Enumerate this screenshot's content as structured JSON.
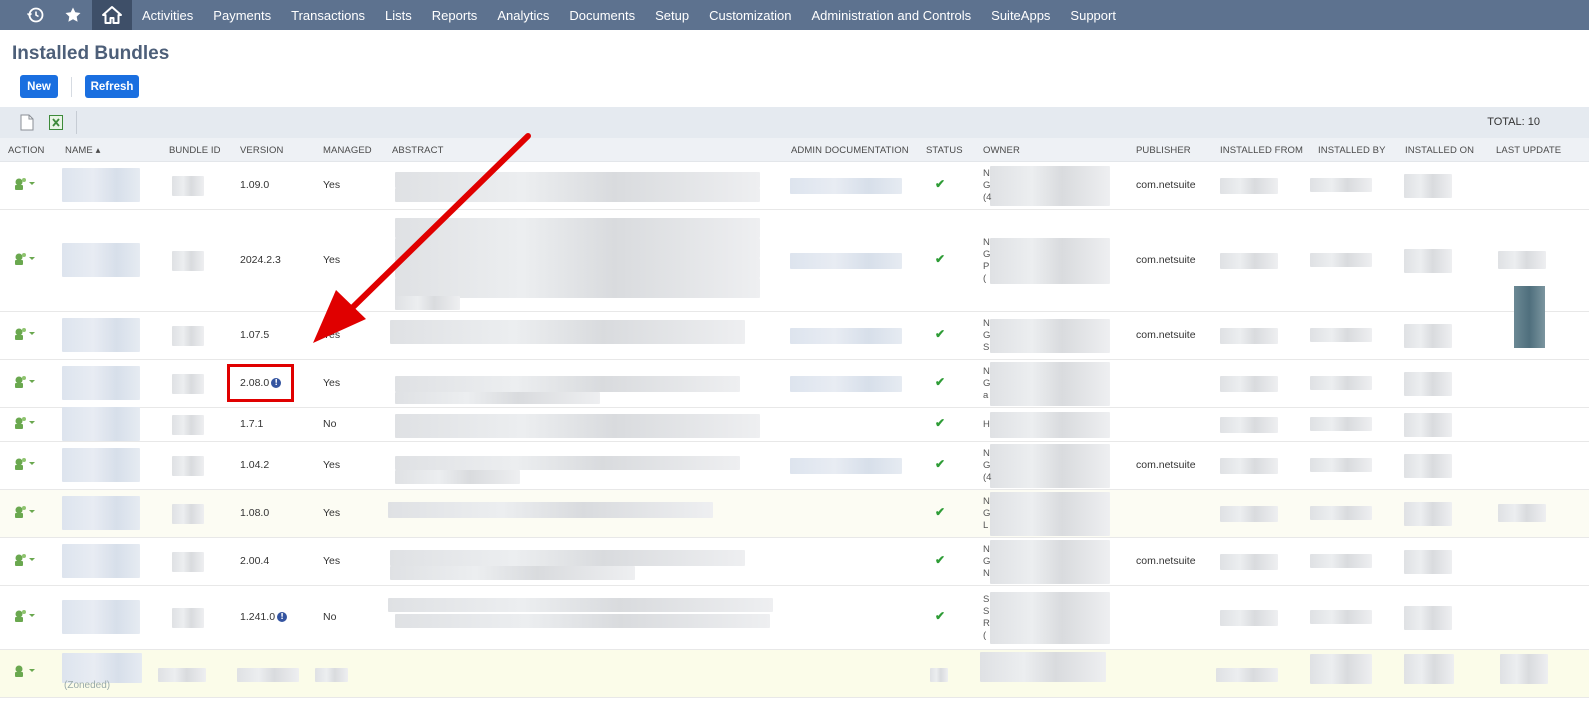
{
  "nav": {
    "items": [
      "Activities",
      "Payments",
      "Transactions",
      "Lists",
      "Reports",
      "Analytics",
      "Documents",
      "Setup",
      "Customization",
      "Administration and Controls",
      "SuiteApps",
      "Support"
    ]
  },
  "page": {
    "title": "Installed Bundles",
    "new_label": "New",
    "refresh_label": "Refresh",
    "total": "TOTAL: 10"
  },
  "columns": [
    "ACTION",
    "NAME ▴",
    "BUNDLE ID",
    "VERSION",
    "MANAGED",
    "ABSTRACT",
    "ADMIN DOCUMENTATION",
    "STATUS",
    "OWNER",
    "PUBLISHER",
    "INSTALLED FROM",
    "INSTALLED BY",
    "INSTALLED ON",
    "LAST UPDATE"
  ],
  "rows": [
    {
      "version": "1.09.0",
      "managed": "Yes",
      "publisher": "com.netsuite",
      "owner_initials": [
        "N",
        "G",
        "(4"
      ]
    },
    {
      "version": "2024.2.3",
      "managed": "Yes",
      "publisher": "com.netsuite",
      "owner_initials": [
        "N",
        "G",
        "P",
        "("
      ]
    },
    {
      "version": "1.07.5",
      "managed": "Yes",
      "publisher": "com.netsuite",
      "owner_initials": [
        "N",
        "G",
        "S"
      ]
    },
    {
      "version": "2.08.0",
      "managed": "Yes",
      "publisher": "",
      "owner_initials": [
        "N",
        "G",
        "a"
      ]
    },
    {
      "version": "1.7.1",
      "managed": "No",
      "publisher": "",
      "owner_initials": [
        "H"
      ]
    },
    {
      "version": "1.04.2",
      "managed": "Yes",
      "publisher": "com.netsuite",
      "owner_initials": [
        "N",
        "G",
        "(4"
      ]
    },
    {
      "version": "1.08.0",
      "managed": "Yes",
      "publisher": "",
      "owner_initials": [
        "N",
        "G",
        "L"
      ]
    },
    {
      "version": "2.00.4",
      "managed": "Yes",
      "publisher": "com.netsuite",
      "owner_initials": [
        "N",
        "G",
        "N"
      ]
    },
    {
      "version": "1.241.0",
      "managed": "No",
      "publisher": "",
      "owner_initials": [
        "S",
        "S",
        "R",
        "("
      ]
    }
  ],
  "footer_text": "(Zoneded)",
  "colors": {
    "nav_bg": "#5d728f",
    "button_blue": "#1a6fe0",
    "annotation_red": "#e00000",
    "status_green": "#2e9c36"
  }
}
